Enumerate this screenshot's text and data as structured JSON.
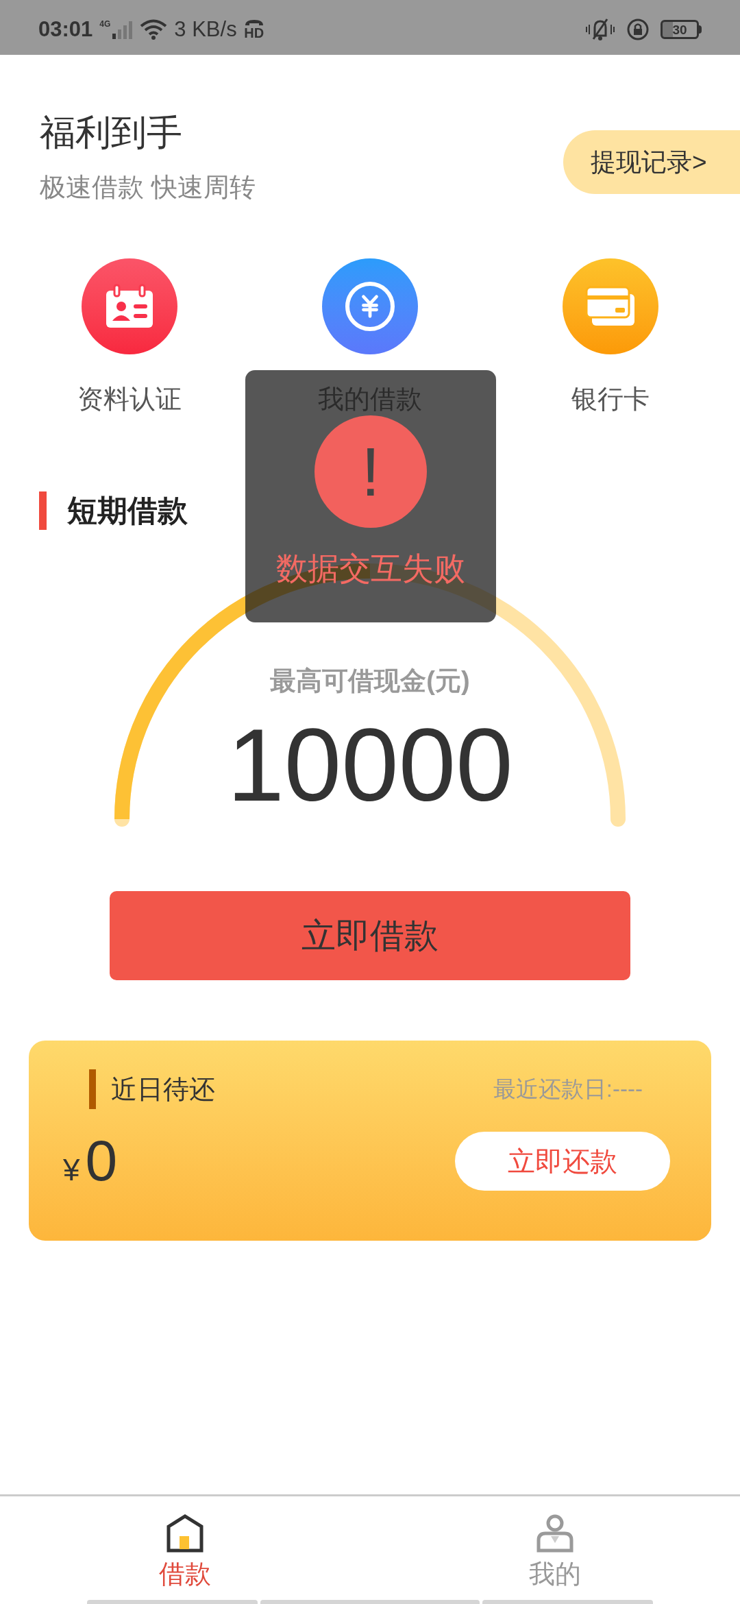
{
  "status_bar": {
    "time": "03:01",
    "network": "4G",
    "speed": "3 KB/s",
    "hd_badge": "HD",
    "battery": "30"
  },
  "header": {
    "title": "福利到手",
    "subtitle": "极速借款 快速周转",
    "record_button": "提现记录>"
  },
  "shortcuts": [
    {
      "kind": "profile",
      "label": "资料认证"
    },
    {
      "kind": "loan",
      "label": "我的借款"
    },
    {
      "kind": "card",
      "label": "银行卡"
    }
  ],
  "section_title": "短期借款",
  "gauge": {
    "label": "最高可借现金(元)",
    "amount": "10000",
    "level": 0.5
  },
  "borrow_button": "立即借款",
  "repay_card": {
    "title": "近日待还",
    "due_date": "最近还款日:----",
    "currency": "¥",
    "amount": "0",
    "button": "立即还款"
  },
  "toast": {
    "icon": "!",
    "message": "数据交互失败"
  },
  "bottom_nav": [
    {
      "kind": "home",
      "label": "借款",
      "selected": true
    },
    {
      "kind": "user",
      "label": "我的",
      "selected": false
    }
  ]
}
